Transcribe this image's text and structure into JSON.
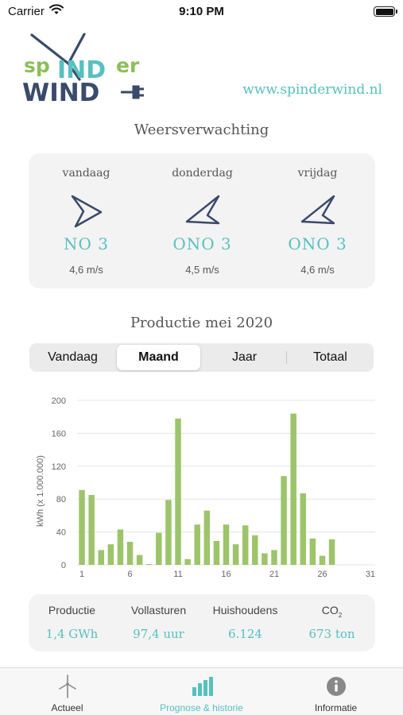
{
  "status_bar": {
    "carrier": "Carrier",
    "time": "9:10 PM"
  },
  "header": {
    "logo_top": "sp",
    "logo_ind": "IND",
    "logo_er": "er",
    "logo_wind": "WIND",
    "website": "www.spinderwind.nl"
  },
  "forecast": {
    "title": "Weersverwachting",
    "days": [
      {
        "name": "vandaag",
        "direction": "NO 3",
        "speed": "4,6 m/s",
        "arrow_angle": 0
      },
      {
        "name": "donderdag",
        "direction": "ONO 3",
        "speed": "4,5 m/s",
        "arrow_angle": -25
      },
      {
        "name": "vrijdag",
        "direction": "ONO 3",
        "speed": "4,6 m/s",
        "arrow_angle": -25
      }
    ]
  },
  "production": {
    "title": "Productie mei 2020",
    "segments": [
      "Vandaag",
      "Maand",
      "Jaar",
      "Totaal"
    ],
    "active_segment": "Maand"
  },
  "chart_data": {
    "type": "bar",
    "ylabel": "kWh (x 1.000.000)",
    "xlabel": "",
    "x_ticks": [
      "1",
      "6",
      "11",
      "16",
      "21",
      "26",
      "31"
    ],
    "y_ticks": [
      "0",
      "40",
      "80",
      "120",
      "160",
      "200"
    ],
    "ylim": [
      0,
      200
    ],
    "xlim": [
      1,
      31
    ],
    "grid": "horizontal",
    "color": "#9dc46b",
    "categories": [
      "1",
      "2",
      "3",
      "4",
      "5",
      "6",
      "7",
      "8",
      "9",
      "10",
      "11",
      "12",
      "13",
      "14",
      "15",
      "16",
      "17",
      "18",
      "19",
      "20",
      "21",
      "22",
      "23",
      "24",
      "25",
      "26",
      "27",
      "28",
      "29",
      "30",
      "31"
    ],
    "values": [
      91,
      85,
      18,
      25,
      43,
      28,
      12,
      1,
      39,
      79,
      178,
      7,
      49,
      66,
      29,
      49,
      25,
      48,
      36,
      14,
      18,
      108,
      184,
      87,
      32,
      11,
      31,
      0,
      0,
      0,
      0
    ]
  },
  "stats": [
    {
      "label": "Productie",
      "value": "1,4 GWh"
    },
    {
      "label": "Vollasturen",
      "value": "97,4 uur"
    },
    {
      "label": "Huishoudens",
      "value": "6.124"
    },
    {
      "label": "CO",
      "label_sub": "2",
      "value": "673 ton"
    }
  ],
  "tabs": [
    {
      "label": "Actueel",
      "icon": "wind-turbine-icon"
    },
    {
      "label": "Prognose & historie",
      "icon": "bar-chart-icon"
    },
    {
      "label": "Informatie",
      "icon": "info-icon"
    }
  ],
  "colors": {
    "accent": "#57c0c0",
    "bar": "#9dc46b",
    "logo_navy": "#3a4a6b"
  }
}
